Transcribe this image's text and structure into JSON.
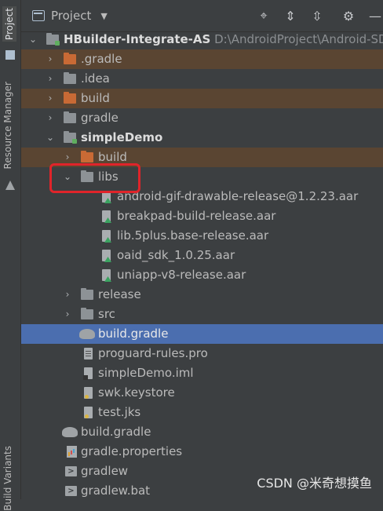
{
  "side_tabs": {
    "project": "Project",
    "resource_manager": "Resource Manager",
    "build_variants": "Build Variants"
  },
  "header": {
    "title": "Project",
    "dropdown": "▼"
  },
  "tree": {
    "root": {
      "name": "HBuilder-Integrate-AS",
      "path": "D:\\AndroidProject\\Android-SDK"
    },
    "gradle_dir": ".gradle",
    "idea_dir": ".idea",
    "build_dir": "build",
    "gradle_folder": "gradle",
    "module": "simpleDemo",
    "module_build": "build",
    "libs": "libs",
    "aar_files": [
      "android-gif-drawable-release@1.2.23.aar",
      "breakpad-build-release.aar",
      "lib.5plus.base-release.aar",
      "oaid_sdk_1.0.25.aar",
      "uniapp-v8-release.aar"
    ],
    "release": "release",
    "src": "src",
    "module_build_gradle": "build.gradle",
    "proguard": "proguard-rules.pro",
    "iml": "simpleDemo.iml",
    "keystore": "swk.keystore",
    "jks": "test.jks",
    "root_build_gradle": "build.gradle",
    "gradle_properties": "gradle.properties",
    "gradlew": "gradlew",
    "gradlew_bat": "gradlew.bat"
  },
  "icons": {
    "chevron_right": "›",
    "chevron_down": "⌄",
    "target": "⌖",
    "expand_all": "⇕",
    "collapse_all": "⇳",
    "settings": "⚙",
    "minimize": "—",
    "terminal": ">"
  },
  "colors": {
    "selected_row": "#4b6eaf",
    "excluded_row": "#5a4532",
    "callout": "#e0242a"
  },
  "watermark": "CSDN @米奇想摸鱼"
}
